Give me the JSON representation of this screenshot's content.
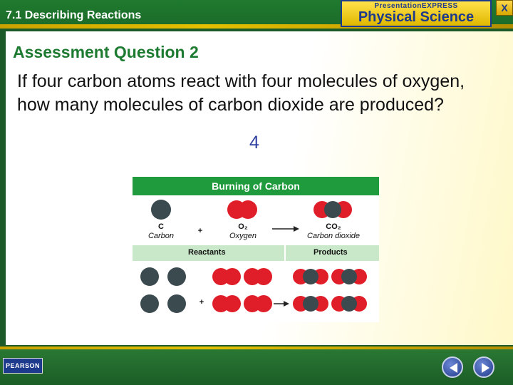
{
  "header": {
    "section_title": "7.1 Describing Reactions",
    "brand_top": "PresentationEXPRESS",
    "brand_main": "Physical Science",
    "close_label": "X"
  },
  "slide": {
    "heading": "Assessment Question 2",
    "question": "If four carbon atoms react with four molecules of oxygen, how many molecules of carbon dioxide are produced?",
    "answer": "4"
  },
  "figure": {
    "title": "Burning of Carbon",
    "equation": {
      "carbon_formula": "C",
      "carbon_name": "Carbon",
      "plus": "+",
      "oxygen_formula": "O₂",
      "oxygen_name": "Oxygen",
      "product_formula": "CO₂",
      "product_name": "Carbon dioxide"
    },
    "reactants_label": "Reactants",
    "products_label": "Products",
    "plus2": "+"
  },
  "footer": {
    "logo_text": "PEARSON",
    "prev_icon": "triangle-left",
    "next_icon": "triangle-right"
  },
  "colors": {
    "carbon": "#3a4a4f",
    "oxygen": "#e01e2a",
    "heading": "#1d7a31",
    "answer": "#2f3fa0"
  }
}
